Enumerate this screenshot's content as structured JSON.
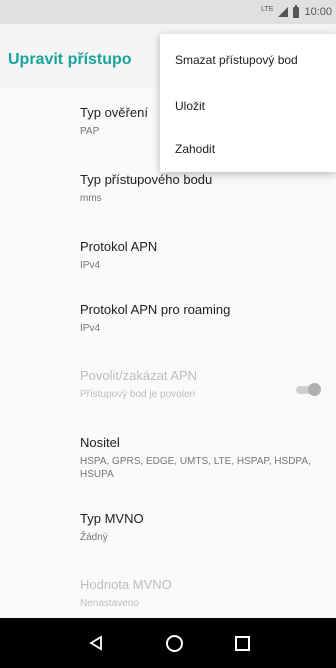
{
  "status_bar": {
    "network": "LTE",
    "time": "10:00",
    "icons": [
      "signal-icon",
      "battery-icon"
    ]
  },
  "app_bar": {
    "title": "Upravit přístupo"
  },
  "menu": {
    "items": [
      {
        "label": "Smazat přístupový bod"
      },
      {
        "label": "Uložit"
      },
      {
        "label": "Zahodit"
      }
    ]
  },
  "settings": [
    {
      "title": "Typ ověření",
      "value": "PAP"
    },
    {
      "title": "Typ přístupového bodu",
      "value": "mms"
    },
    {
      "title": "Protokol APN",
      "value": "IPv4"
    },
    {
      "title": "Protokol APN pro roaming",
      "value": "IPv4"
    },
    {
      "title": "Povolit/zakázat APN",
      "value": "Přístupový bod je povolen",
      "disabled": true
    },
    {
      "title": "Nositel",
      "value": "HSPA, GPRS, EDGE, UMTS, LTE, HSPAP, HSDPA, HSUPA"
    },
    {
      "title": "Typ MVNO",
      "value": "Žádný"
    },
    {
      "title": "Hodnota MVNO",
      "value": "Nenastaveno",
      "disabled": true
    }
  ],
  "toggle": {
    "label_ref": "Povolit/zakázat APN",
    "state": "on",
    "enabled": false
  },
  "nav_bar": {
    "icons": [
      "back-icon",
      "home-icon",
      "recents-icon"
    ]
  },
  "colors": {
    "accent": "#1aa39b",
    "nav_bar": "#000000",
    "status_bar": "#e0e0e0"
  }
}
